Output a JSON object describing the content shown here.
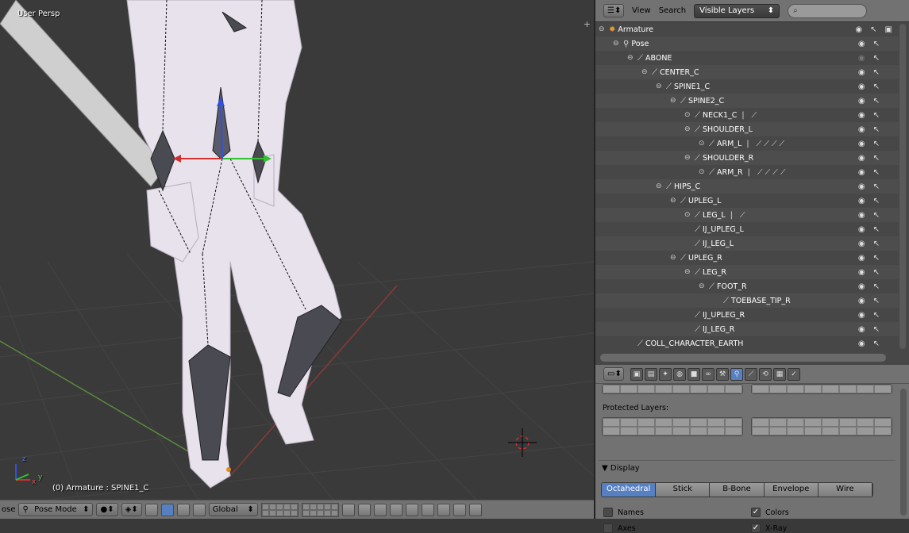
{
  "viewport": {
    "persp_label": "User Persp",
    "object_label": "(0) Armature : SPINE1_C",
    "axis_x": "x",
    "axis_y": "y",
    "axis_z": "z"
  },
  "toolbar": {
    "partial_label": "ose",
    "mode": "Pose Mode",
    "orientation": "Global"
  },
  "outliner": {
    "menu_view": "View",
    "menu_search": "Search",
    "filter": "Visible Layers",
    "rows": [
      {
        "label": "Armature",
        "indent": 0,
        "expand": "⊖",
        "icon": "armature-icon"
      },
      {
        "label": "Pose",
        "indent": 1,
        "expand": "⊖",
        "icon": "pose-icon"
      },
      {
        "label": "ABONE",
        "indent": 2,
        "expand": "⊖",
        "icon": "bone-icon"
      },
      {
        "label": "CENTER_C",
        "indent": 3,
        "expand": "⊖",
        "icon": "bone-icon"
      },
      {
        "label": "SPINE1_C",
        "indent": 4,
        "expand": "⊖",
        "icon": "bone-icon"
      },
      {
        "label": "SPINE2_C",
        "indent": 5,
        "expand": "⊖",
        "icon": "bone-icon"
      },
      {
        "label": "NECK1_C",
        "indent": 6,
        "expand": "⊙",
        "icon": "bone-icon",
        "extra": "| ⟋"
      },
      {
        "label": "SHOULDER_L",
        "indent": 6,
        "expand": "⊖",
        "icon": "bone-icon"
      },
      {
        "label": "ARM_L",
        "indent": 7,
        "expand": "⊙",
        "icon": "bone-icon",
        "extra": "| ⟋⟋⟋⟋"
      },
      {
        "label": "SHOULDER_R",
        "indent": 6,
        "expand": "⊖",
        "icon": "bone-icon"
      },
      {
        "label": "ARM_R",
        "indent": 7,
        "expand": "⊙",
        "icon": "bone-icon",
        "extra": "| ⟋⟋⟋⟋"
      },
      {
        "label": "HIPS_C",
        "indent": 4,
        "expand": "⊖",
        "icon": "bone-icon"
      },
      {
        "label": "UPLEG_L",
        "indent": 5,
        "expand": "⊖",
        "icon": "bone-icon"
      },
      {
        "label": "LEG_L",
        "indent": 6,
        "expand": "⊙",
        "icon": "bone-icon",
        "extra": "| ⟋"
      },
      {
        "label": "IJ_UPLEG_L",
        "indent": 6,
        "expand": "",
        "icon": "bone-icon"
      },
      {
        "label": "IJ_LEG_L",
        "indent": 6,
        "expand": "",
        "icon": "bone-icon"
      },
      {
        "label": "UPLEG_R",
        "indent": 5,
        "expand": "⊖",
        "icon": "bone-icon"
      },
      {
        "label": "LEG_R",
        "indent": 6,
        "expand": "⊖",
        "icon": "bone-icon"
      },
      {
        "label": "FOOT_R",
        "indent": 7,
        "expand": "⊖",
        "icon": "bone-icon"
      },
      {
        "label": "TOEBASE_TIP_R",
        "indent": 8,
        "expand": "",
        "icon": "bone-icon"
      },
      {
        "label": "IJ_UPLEG_R",
        "indent": 6,
        "expand": "",
        "icon": "bone-icon"
      },
      {
        "label": "IJ_LEG_R",
        "indent": 6,
        "expand": "",
        "icon": "bone-icon"
      },
      {
        "label": "COLL_CHARACTER_EARTH",
        "indent": 2,
        "expand": "",
        "icon": "bone-icon"
      }
    ]
  },
  "properties": {
    "protected_layers": "Protected Layers:",
    "display_header": "▼ Display",
    "display_modes": [
      "Octahedral",
      "Stick",
      "B-Bone",
      "Envelope",
      "Wire"
    ],
    "active_mode": "Octahedral",
    "checks": {
      "names": {
        "label": "Names",
        "checked": false
      },
      "axes": {
        "label": "Axes",
        "checked": false
      },
      "colors": {
        "label": "Colors",
        "checked": true
      },
      "xray": {
        "label": "X-Ray",
        "checked": true
      }
    }
  }
}
